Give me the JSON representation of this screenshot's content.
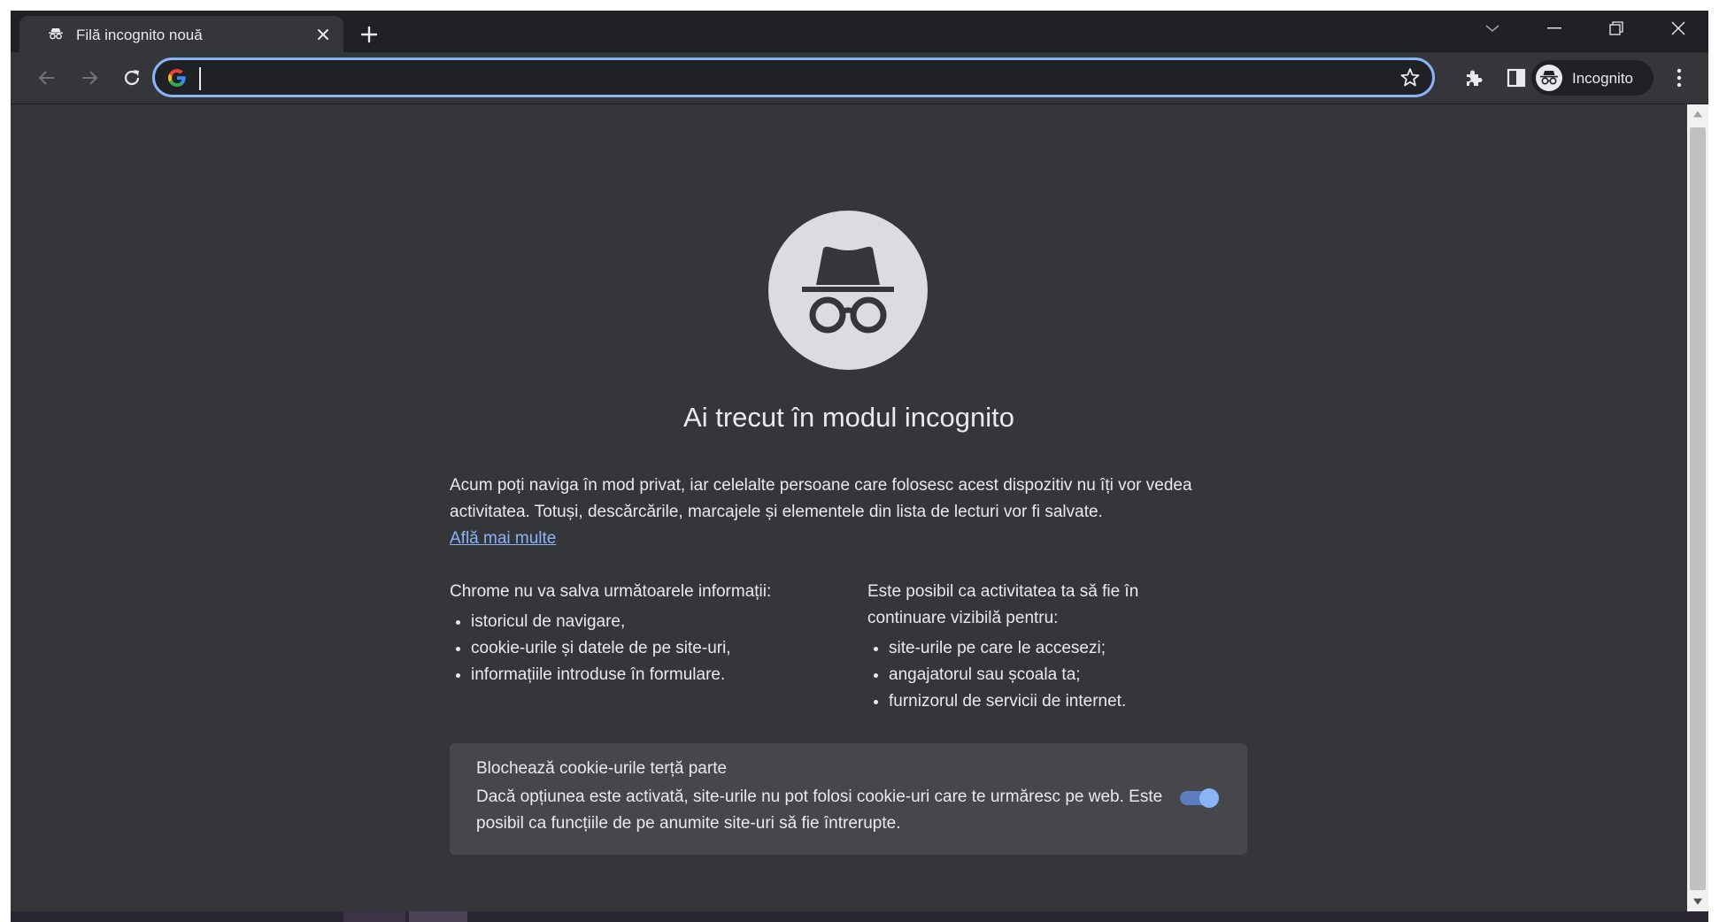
{
  "tab": {
    "title": "Filă incognito nouă",
    "icon": "incognito-icon"
  },
  "toolbar": {
    "address_value": "",
    "profile_label": "Incognito"
  },
  "page": {
    "heading": "Ai trecut în modul incognito",
    "intro_text": "Acum poți naviga în mod privat, iar celelalte persoane care folosesc acest dispozitiv nu îți vor vedea activitatea. Totuși, descărcările, marcajele și elementele din lista de lecturi vor fi salvate.",
    "learn_more": "Află mai multe",
    "not_saved_title": "Chrome nu va salva următoarele informații:",
    "not_saved_items": [
      "istoricul de navigare,",
      "cookie-urile și datele de pe site-uri,",
      "informațiile introduse în formulare."
    ],
    "visible_title": "Este posibil ca activitatea ta să fie în continuare vizibilă pentru:",
    "visible_items": [
      "site-urile pe care le accesezi;",
      "angajatorul sau școala ta;",
      "furnizorul de servicii de internet."
    ],
    "cookie_card": {
      "title": "Blochează cookie-urile terță parte",
      "description": "Dacă opțiunea este activată, site-urile nu pot folosi cookie-uri care te urmăresc pe web. Este posibil ca funcțiile de pe anumite site-uri să fie întrerupte.",
      "toggle_on": true
    }
  },
  "colors": {
    "accent": "#8ab4f8",
    "page_bg": "#35363a",
    "frame_bg": "#202124",
    "text": "#e8eaed"
  }
}
